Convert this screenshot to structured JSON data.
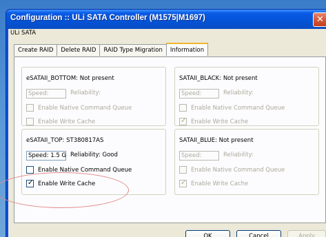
{
  "window": {
    "title": "Configuration :: ULi SATA Controller (M1575|M1697)",
    "subtitle": "ULi SATA",
    "close_glyph": "✕"
  },
  "tabs": [
    {
      "label": "Create RAID",
      "active": false
    },
    {
      "label": "Delete RAID",
      "active": false
    },
    {
      "label": "RAID Type Migration",
      "active": false
    },
    {
      "label": "Information",
      "active": true
    }
  ],
  "ports": {
    "esata_bottom": {
      "label": "eSATAII_BOTTOM: Not present",
      "speed": "Speed:",
      "reliability": "Reliability:",
      "ncq": "Enable Native Command Queue",
      "write_cache": "Enable Write Cache",
      "ncq_checked": false,
      "write_cache_checked": false,
      "enabled": false
    },
    "satai_black": {
      "label": "SATAII_BLACK: Not present",
      "speed": "Speed:",
      "reliability": "Reliability:",
      "ncq": "Enable Native Command Queue",
      "write_cache": "Enable Write Cache",
      "ncq_checked": false,
      "write_cache_checked": true,
      "enabled": false
    },
    "esata_top": {
      "label": "eSATAII_TOP: ST380817AS",
      "speed": "Speed: 1.5 G",
      "reliability": "Reliability: Good",
      "ncq": "Enable Native Command Queue",
      "write_cache": "Enable Write Cache",
      "ncq_checked": false,
      "write_cache_checked": true,
      "enabled": true
    },
    "satai_blue": {
      "label": "SATAII_BLUE: Not present",
      "speed": "Speed:",
      "reliability": "Reliability:",
      "ncq": "Enable Native Command Queue",
      "write_cache": "Enable Write Cache",
      "ncq_checked": false,
      "write_cache_checked": true,
      "enabled": false
    }
  },
  "buttons": {
    "ok": "OK",
    "cancel": "Cancel",
    "apply": "Apply"
  },
  "colors": {
    "titlebar": "#0453d6",
    "annotation_ellipse": "#e48a8a",
    "disabled_text": "#aca899"
  }
}
